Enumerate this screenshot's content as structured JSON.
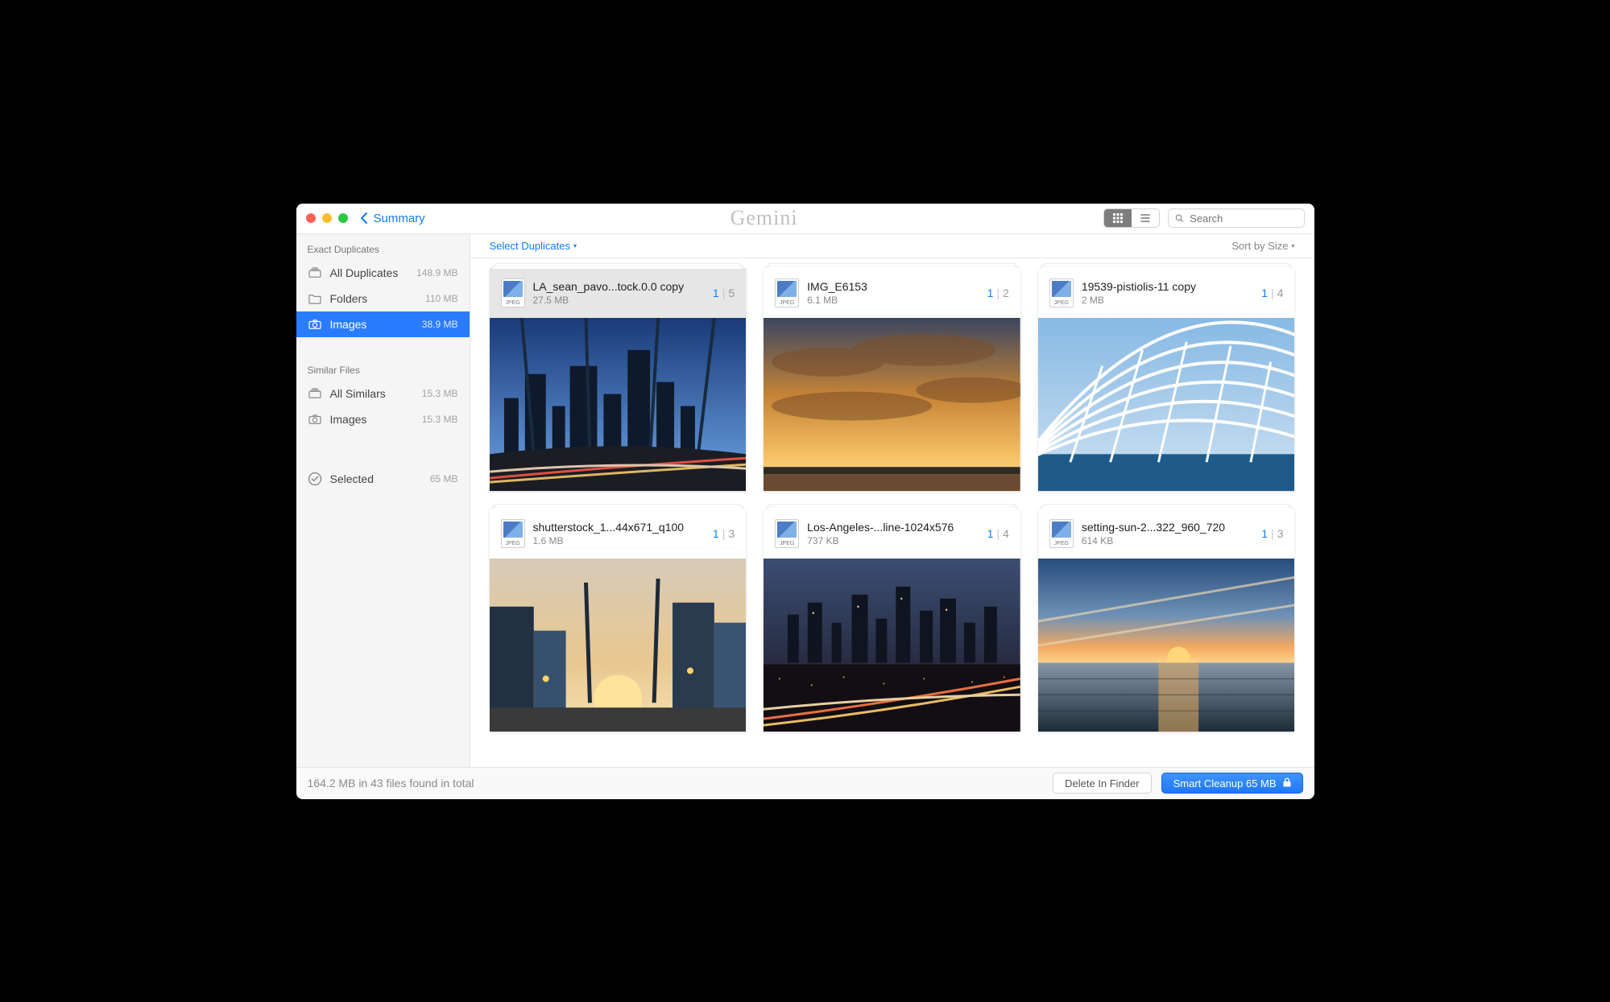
{
  "app": {
    "logo_text": "Gemini",
    "back_label": "Summary"
  },
  "toolbar": {
    "search_placeholder": "Search"
  },
  "sidebar": {
    "sections": [
      {
        "title": "Exact Duplicates",
        "items": [
          {
            "id": "all-dup",
            "icon": "stack",
            "label": "All Duplicates",
            "meta": "148.9 MB"
          },
          {
            "id": "folders",
            "icon": "folder",
            "label": "Folders",
            "meta": "110 MB"
          },
          {
            "id": "images",
            "icon": "camera",
            "label": "Images",
            "meta": "38.9 MB",
            "active": true
          }
        ]
      },
      {
        "title": "Similar Files",
        "items": [
          {
            "id": "all-sim",
            "icon": "stack",
            "label": "All Similars",
            "meta": "15.3 MB"
          },
          {
            "id": "images-sim",
            "icon": "camera",
            "label": "Images",
            "meta": "15.3 MB"
          }
        ]
      }
    ],
    "selected": {
      "icon": "check",
      "label": "Selected",
      "meta": "65 MB"
    }
  },
  "subbar": {
    "select_label": "Select Duplicates",
    "sort_label": "Sort by Size"
  },
  "cards": [
    {
      "name": "LA_sean_pavo...tock.0.0 copy",
      "size": "27.5 MB",
      "selected": 1,
      "total": 5,
      "is_selected": true,
      "thumb": "la_skyline"
    },
    {
      "name": "IMG_E6153",
      "size": "6.1 MB",
      "selected": 1,
      "total": 2,
      "is_selected": false,
      "thumb": "sunset_clouds"
    },
    {
      "name": "19539-pistiolis-11 copy",
      "size": "2 MB",
      "selected": 1,
      "total": 4,
      "is_selected": false,
      "thumb": "white_arch"
    },
    {
      "name": "shutterstock_1...44x671_q100",
      "size": "1.6 MB",
      "selected": 1,
      "total": 3,
      "is_selected": false,
      "thumb": "hollywood"
    },
    {
      "name": "Los-Angeles-...line-1024x576",
      "size": "737 KB",
      "selected": 1,
      "total": 4,
      "is_selected": false,
      "thumb": "night_city"
    },
    {
      "name": "setting-sun-2...322_960_720",
      "size": "614 KB",
      "selected": 1,
      "total": 3,
      "is_selected": false,
      "thumb": "sea_sunset"
    }
  ],
  "jpeg_badge": "JPEG",
  "footer": {
    "status": "164.2 MB in 43 files found in total",
    "delete_label": "Delete In Finder",
    "cleanup_label": "Smart Cleanup 65 MB"
  }
}
